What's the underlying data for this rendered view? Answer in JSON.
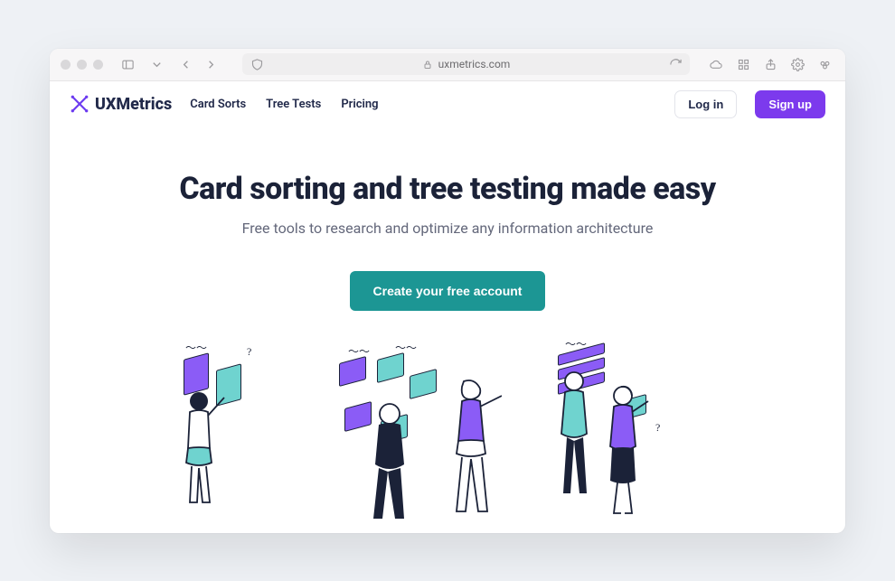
{
  "browser": {
    "url_display": "uxmetrics.com"
  },
  "site": {
    "brand": "UXMetrics",
    "nav": {
      "card_sorts": "Card Sorts",
      "tree_tests": "Tree Tests",
      "pricing": "Pricing"
    },
    "auth": {
      "login": "Log in",
      "signup": "Sign up"
    }
  },
  "hero": {
    "headline": "Card sorting and tree testing made easy",
    "subheadline": "Free tools to research and optimize any information architecture",
    "cta": "Create your free account"
  },
  "colors": {
    "accent_purple": "#7c3aed",
    "accent_teal": "#1c9694",
    "text_dark": "#1b2238"
  }
}
